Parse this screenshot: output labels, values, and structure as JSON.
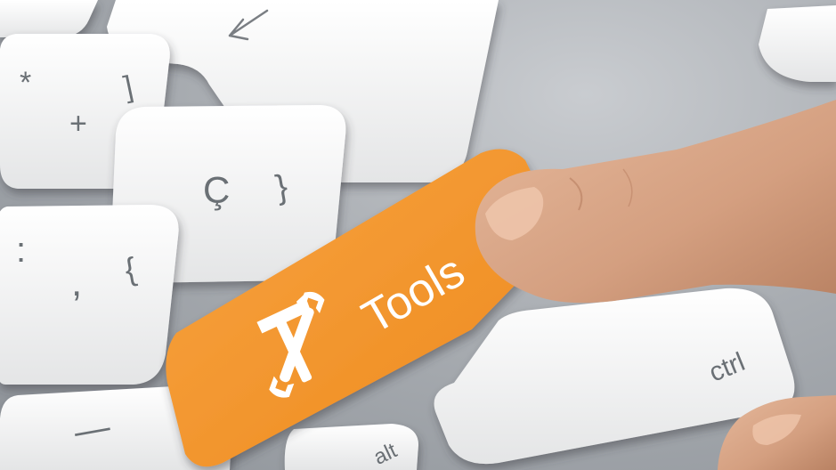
{
  "keys": {
    "tools_label": "Tools",
    "ctrl_label": "ctrl",
    "alt_label": "alt",
    "asterisk": "*",
    "plus": "+",
    "bracket_close": "]",
    "c_cedilla": "Ç",
    "brace_close": "}",
    "colon": ":",
    "comma": ",",
    "brace_open": "{",
    "minus": "—",
    "arrow": "←"
  },
  "colors": {
    "tools_key": "#f39226",
    "key_white": "#f4f4f3",
    "skin": "#d9a98a"
  },
  "icons": [
    "hammer-wrench-icon"
  ]
}
